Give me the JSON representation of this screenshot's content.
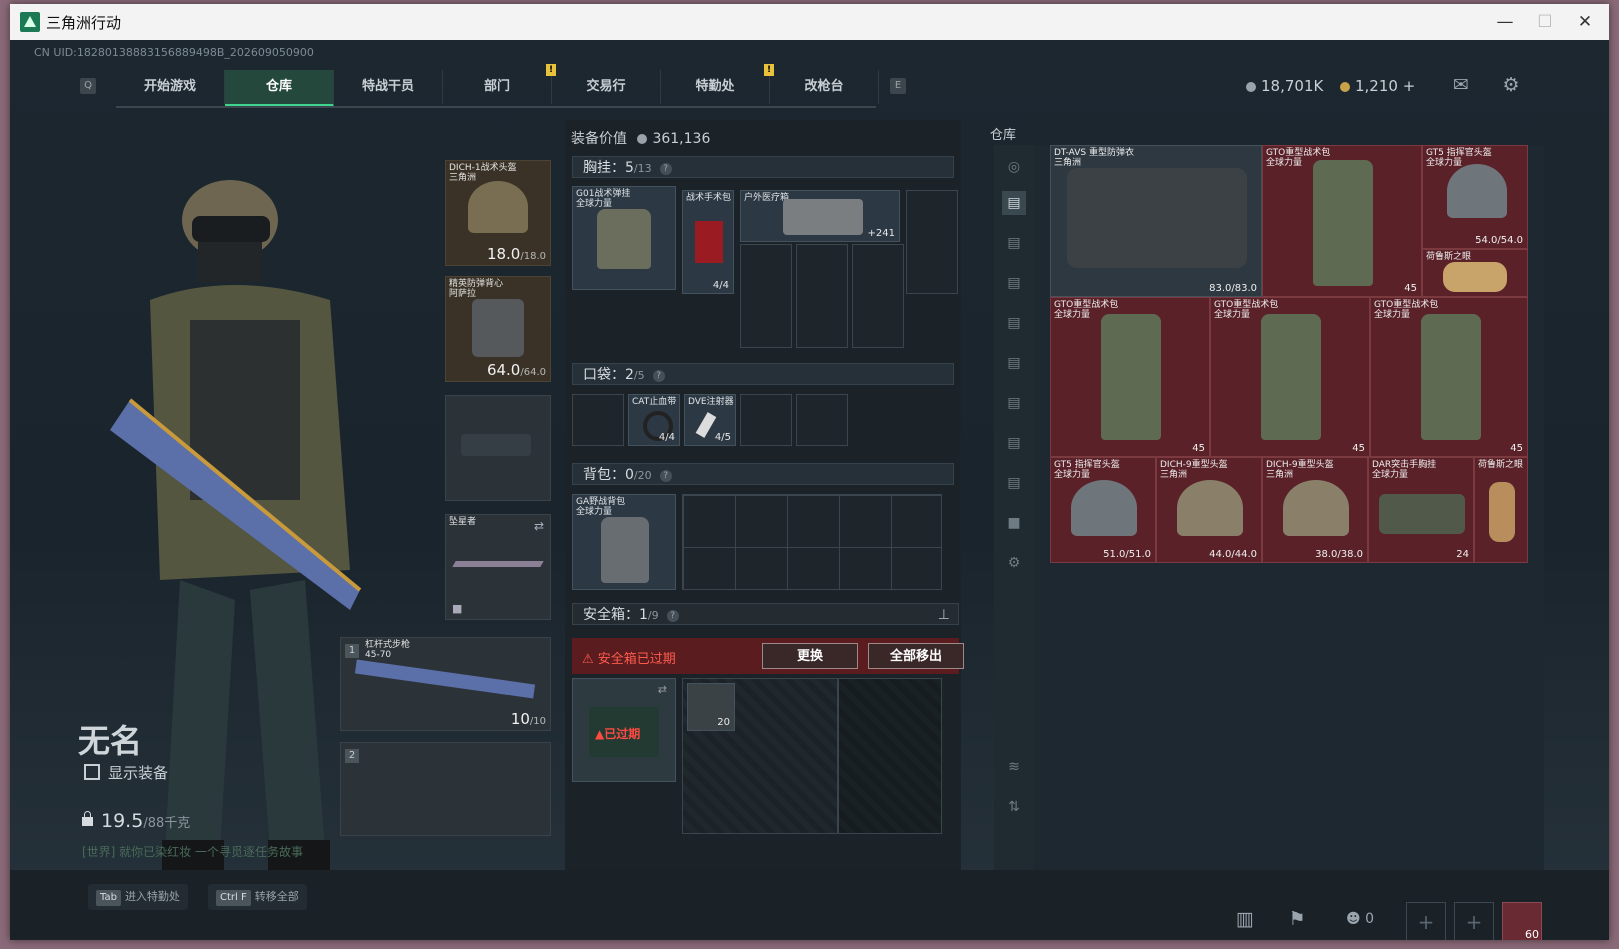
{
  "window": {
    "title": "三角洲行动",
    "minimize": "—",
    "maximize": "☐",
    "close": "✕"
  },
  "uid": "CN UID:18280138883156889498B_202609050900",
  "nav": {
    "key_left": "Q",
    "key_right": "E",
    "tabs": [
      "开始游戏",
      "仓库",
      "特战干员",
      "部门",
      "交易行",
      "特勤处",
      "改枪台"
    ],
    "active": "仓库",
    "badge": "!"
  },
  "currency": {
    "silver": "18,701K",
    "gold": "1,210",
    "plus": "+"
  },
  "player": {
    "name": "无名",
    "show_equipment": "显示装备",
    "weight": "19.5",
    "weight_max": "/88千克",
    "notice": "[世界] 就你已染红妆 一个寻觅逐任务故事"
  },
  "hotkeys": [
    {
      "key": "Tab",
      "label": "进入特勤处"
    },
    {
      "key": "Ctrl F",
      "label": "转移全部"
    }
  ],
  "equipment": {
    "helmet": {
      "name": "DICH-1战术头盔",
      "brand": "三角洲",
      "dur": "18.0",
      "max": "/18.0"
    },
    "armor": {
      "name": "精英防弹背心",
      "brand": "阿萨拉",
      "dur": "64.0",
      "max": "/64.0"
    },
    "melee": {
      "name": "坠星者"
    },
    "weapon1": {
      "slot": "1",
      "name": "杠杆式步枪",
      "ammo_note": "45-70",
      "ammo": "10",
      "ammo_max": "/10"
    },
    "weapon2": {
      "slot": "2"
    }
  },
  "loadout": {
    "header": "装备价值",
    "value": "361,136",
    "chest": {
      "label": "胸挂：",
      "count": "5",
      "max": "/13",
      "help": "?"
    },
    "chest_items": [
      {
        "name": "G01战术弹挂",
        "brand": "全球力量"
      },
      {
        "name": "战术手术包",
        "count": "4/4"
      },
      {
        "name": "户外医疗箱",
        "count": "+241"
      }
    ],
    "pocket": {
      "label": "口袋：",
      "count": "2",
      "max": "/5",
      "help": "?"
    },
    "pocket_items": [
      {
        "name": "CAT止血带",
        "count": "4/4"
      },
      {
        "name": "DVE注射器",
        "count": "4/5"
      }
    ],
    "backpack": {
      "label": "背包：",
      "count": "0",
      "max": "/20",
      "help": "?"
    },
    "backpack_item": {
      "name": "GA野战背包",
      "brand": "全球力量"
    },
    "safebox": {
      "label": "安全箱：",
      "count": "1",
      "max": "/9",
      "help": "?"
    },
    "safebox_warning": "安全箱已过期",
    "replace_label": "更换",
    "move_all_label": "全部移出",
    "expired_label": "已过期",
    "safebox_item_count": "20"
  },
  "warehouse": {
    "title": "仓库",
    "items": [
      {
        "name": "DT-AVS 重型防弹衣",
        "brand": "三角洲",
        "count": "83.0/83.0"
      },
      {
        "name": "GTO重型战术包",
        "brand": "全球力量",
        "count": "45"
      },
      {
        "name": "GT5 指挥官头盔",
        "brand": "全球力量",
        "count": "54.0/54.0"
      },
      {
        "name": "荷鲁斯之眼",
        "brand": "",
        "count": ""
      },
      {
        "name": "GTO重型战术包",
        "brand": "全球力量",
        "count": "45"
      },
      {
        "name": "GTO重型战术包",
        "brand": "全球力量",
        "count": "45"
      },
      {
        "name": "GTO重型战术包",
        "brand": "全球力量",
        "count": "45"
      },
      {
        "name": "GT5 指挥官头盔",
        "brand": "全球力量",
        "count": "51.0/51.0"
      },
      {
        "name": "DICH-9重型头盔",
        "brand": "三角洲",
        "count": "44.0/44.0"
      },
      {
        "name": "DICH-9重型头盔",
        "brand": "三角洲",
        "count": "38.0/38.0"
      },
      {
        "name": "DAR突击手胸挂",
        "brand": "全球力量",
        "count": "24"
      },
      {
        "name": "荷鲁斯之眼",
        "brand": "",
        "count": ""
      }
    ]
  },
  "bottom_right": {
    "team_count": "0",
    "level": "60"
  },
  "colors": {
    "accent": "#3fd58e",
    "expired": "#ff5a4e",
    "gold_item": "#5a2128",
    "badge": "#e8c23a"
  }
}
